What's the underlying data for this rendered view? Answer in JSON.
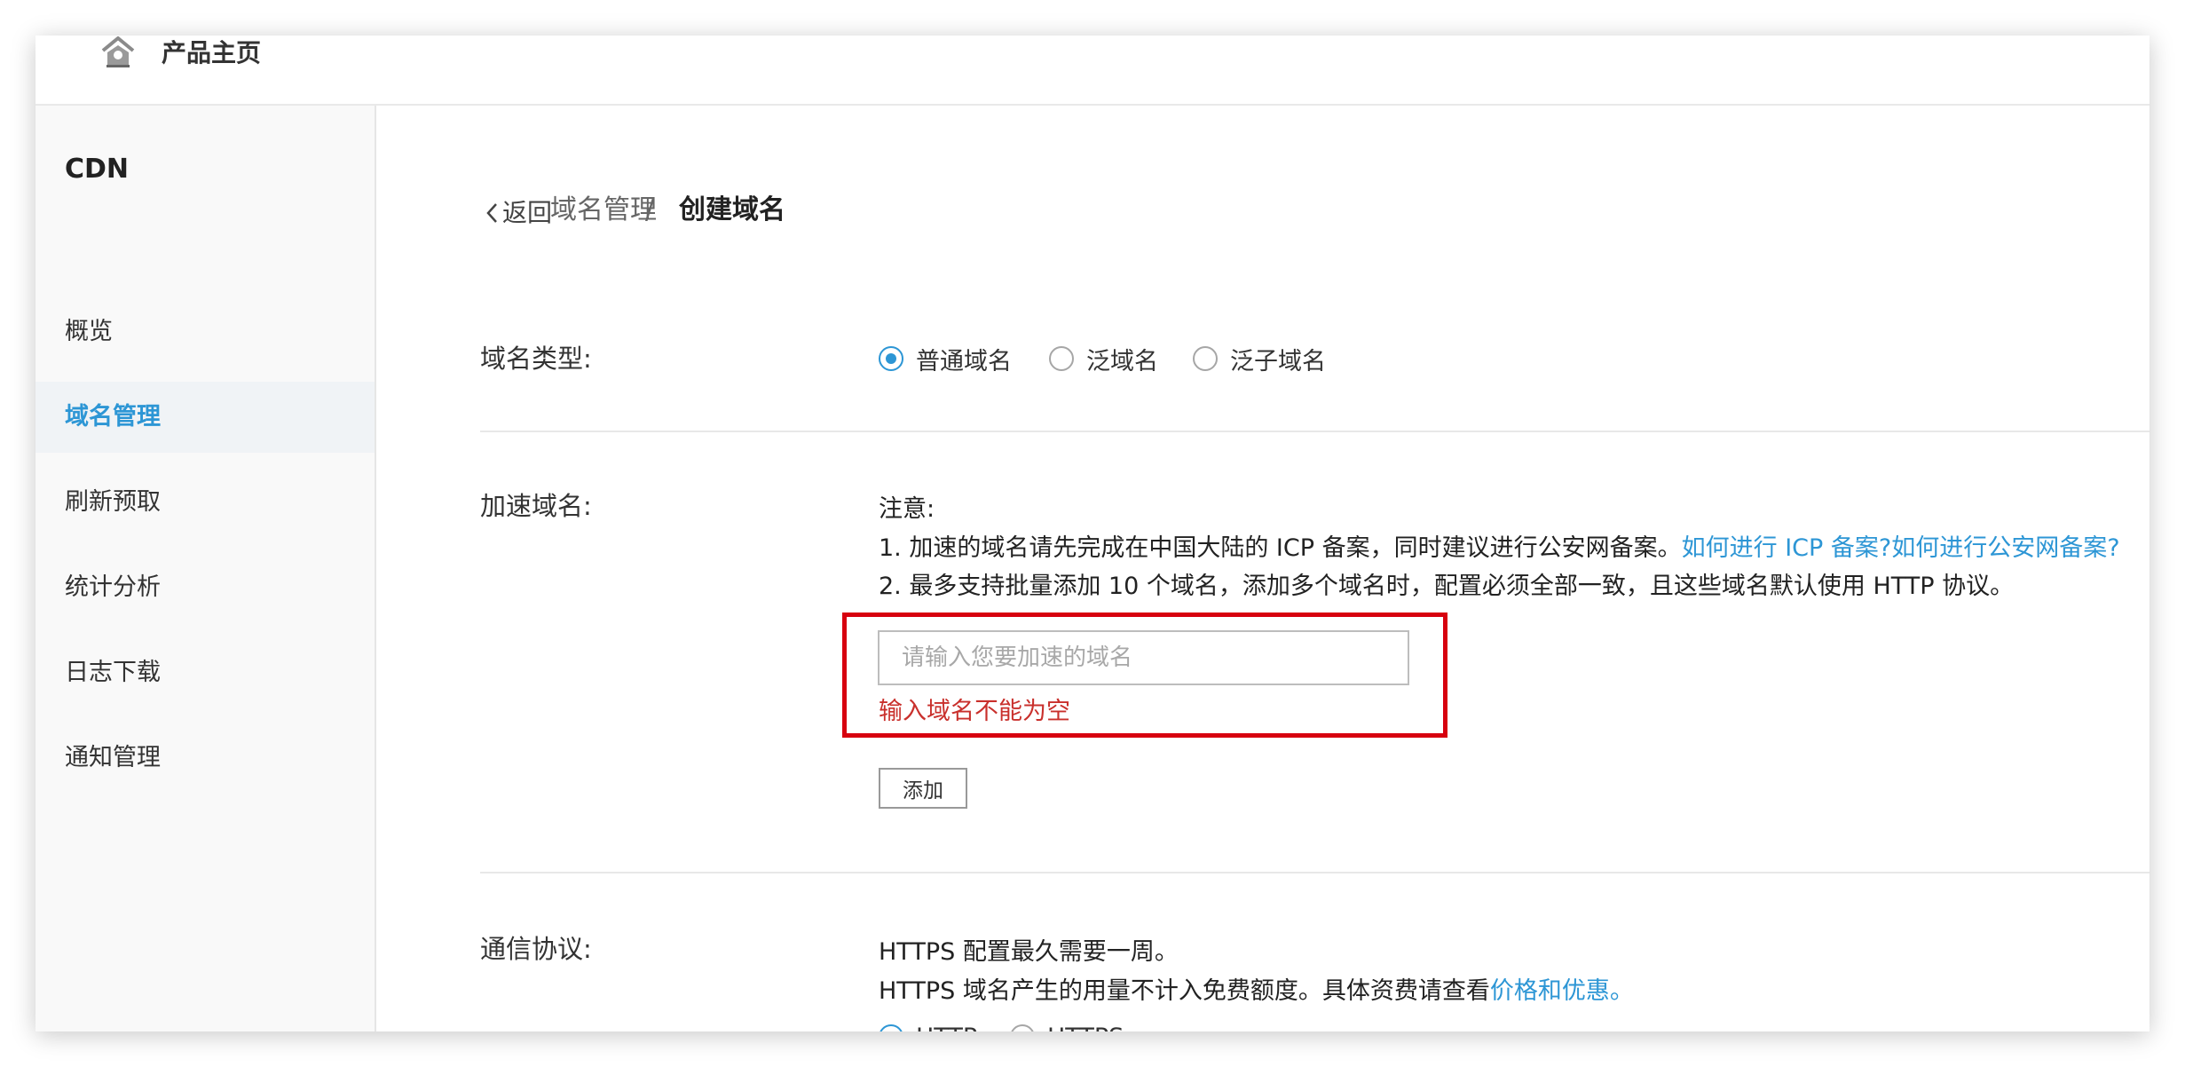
{
  "topbar": {
    "home_icon": "home-icon",
    "home_label": "产品主页"
  },
  "sidebar": {
    "title": "CDN",
    "items": [
      {
        "label": "概览",
        "active": false
      },
      {
        "label": "域名管理",
        "active": true
      },
      {
        "label": "刷新预取",
        "active": false
      },
      {
        "label": "统计分析",
        "active": false
      },
      {
        "label": "日志下载",
        "active": false
      },
      {
        "label": "通知管理",
        "active": false
      }
    ]
  },
  "header": {
    "back_label": "返回",
    "breadcrumb_parent": "域名管理",
    "breadcrumb_separator": "/",
    "breadcrumb_current": "创建域名"
  },
  "domain_type": {
    "label": "域名类型:",
    "options": [
      {
        "label": "普通域名",
        "checked": true
      },
      {
        "label": "泛域名",
        "checked": false
      },
      {
        "label": "泛子域名",
        "checked": false
      }
    ]
  },
  "accel_domain": {
    "label": "加速域名:",
    "note_title": "注意:",
    "note_line1": "1. 加速的域名请先完成在中国大陆的 ICP 备案，同时建议进行公安网备案。",
    "note_link1": "如何进行 ICP 备案?",
    "note_link2": "如何进行公安网备案?",
    "note_line2": "2. 最多支持批量添加 10 个域名，添加多个域名时，配置必须全部一致，且这些域名默认使用 HTTP 协议。",
    "input_value": "",
    "input_placeholder": "请输入您要加速的域名",
    "error_message": "输入域名不能为空",
    "add_button": "添加"
  },
  "protocol": {
    "label": "通信协议:",
    "line1": "HTTPS 配置最久需要一周。",
    "line2_prefix": "HTTPS 域名产生的用量不计入免费额度。具体资费请查看",
    "line2_link": "价格和优惠。",
    "options": [
      {
        "label": "HTTP",
        "checked": true
      },
      {
        "label": "HTTPS",
        "checked": false
      }
    ]
  },
  "colors": {
    "accent": "#2d96d5",
    "error_text": "#c9302c",
    "error_highlight": "#d7000f"
  }
}
